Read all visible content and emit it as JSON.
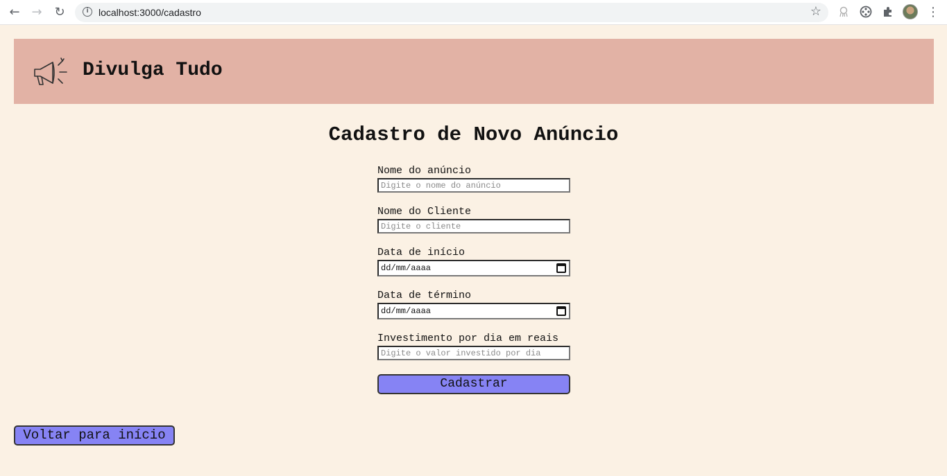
{
  "browser": {
    "url": "localhost:3000/cadastro",
    "back_icon": "arrow-left-icon",
    "forward_icon": "arrow-right-icon",
    "reload_icon": "reload-icon",
    "info_icon": "info-icon",
    "bookmark_icon": "star-icon",
    "extensions": [
      "octopus-extension-icon",
      "film-extension-icon",
      "puzzle-extensions-icon"
    ],
    "profile_icon": "profile-avatar",
    "menu_icon": "kebab-menu-icon"
  },
  "header": {
    "logo_icon": "megaphone-icon",
    "brand": "Divulga Tudo",
    "background_color": "#e2b2a5"
  },
  "page": {
    "title": "Cadastro de Novo Anúncio",
    "background_color": "#fbf1e4"
  },
  "form": {
    "ad_name": {
      "label": "Nome do anúncio",
      "placeholder": "Digite o nome do anúncio",
      "value": ""
    },
    "client_name": {
      "label": "Nome do Cliente",
      "placeholder": "Digite o cliente",
      "value": ""
    },
    "start_date": {
      "label": "Data de início",
      "value": "dd/mm/aaaa"
    },
    "end_date": {
      "label": "Data de término",
      "value": "dd/mm/aaaa"
    },
    "investment": {
      "label": "Investimento por dia em reais",
      "placeholder": "Digite o valor investido por dia",
      "value": ""
    },
    "submit_label": "Cadastrar",
    "button_color": "#8683f4"
  },
  "back_button": {
    "label": "Voltar para início"
  }
}
